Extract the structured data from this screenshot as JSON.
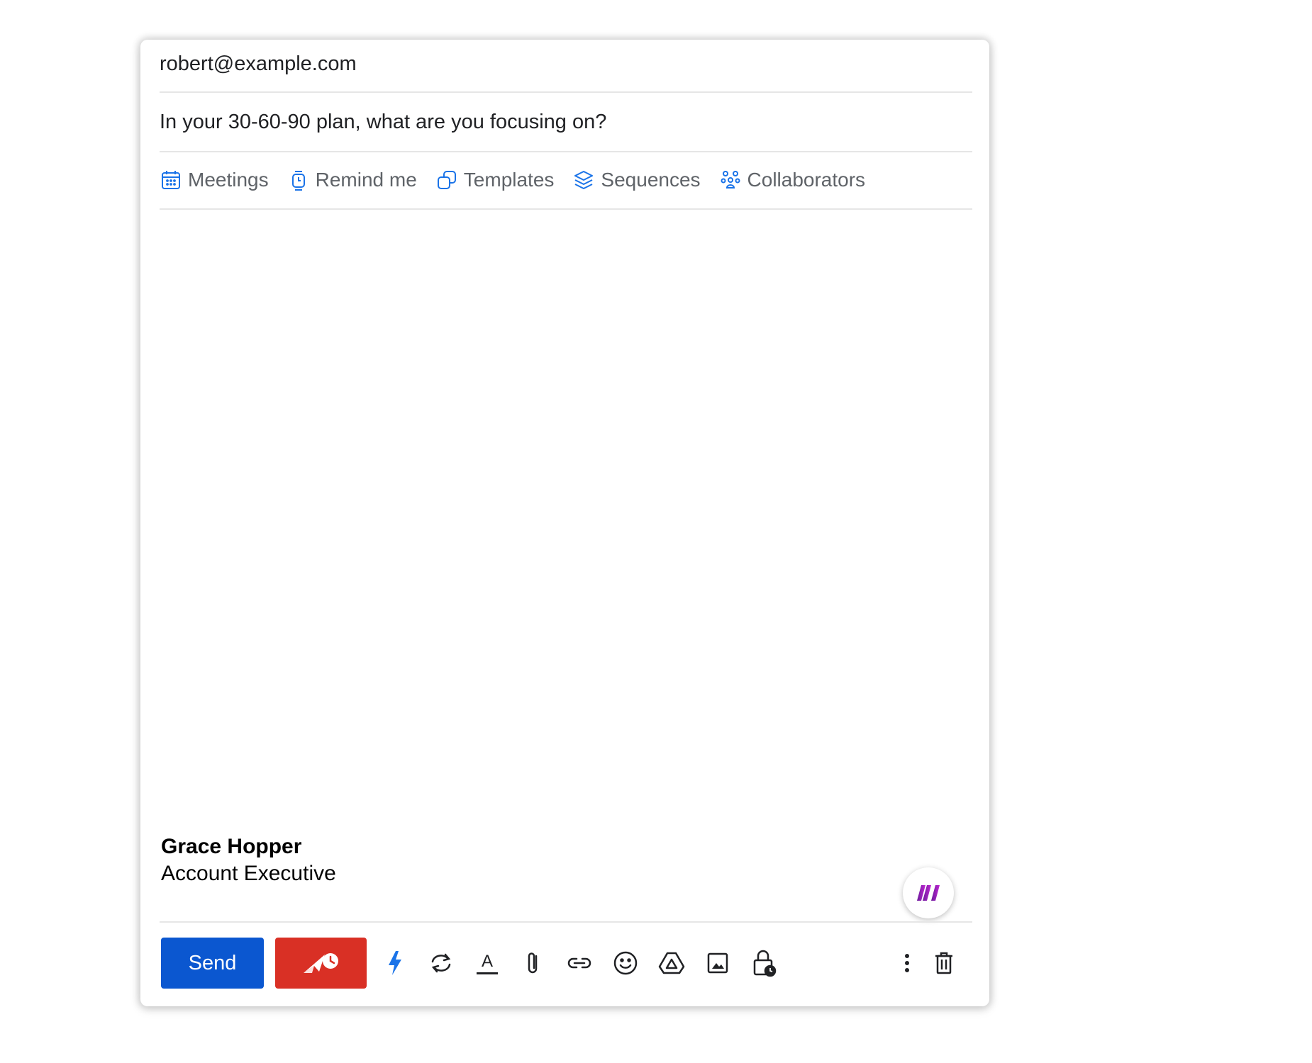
{
  "compose": {
    "to": "robert@example.com",
    "subject": "In your 30-60-90 plan, what are you focusing on?",
    "chips": [
      {
        "label": "Meetings",
        "icon": "calendar-icon"
      },
      {
        "label": "Remind me",
        "icon": "watch-icon"
      },
      {
        "label": "Templates",
        "icon": "templates-icon"
      },
      {
        "label": "Sequences",
        "icon": "layers-icon"
      },
      {
        "label": "Collaborators",
        "icon": "people-icon"
      }
    ],
    "signature": {
      "name": "Grace Hopper",
      "title": "Account Executive"
    }
  },
  "toolbar": {
    "send_label": "Send",
    "tools": [
      "lightning-icon",
      "sync-icon",
      "text-format-icon",
      "attachment-icon",
      "link-icon",
      "emoji-icon",
      "drive-icon",
      "image-icon",
      "confidential-lock-icon",
      "more-options-icon",
      "trash-icon"
    ]
  },
  "colors": {
    "send": "#0b57d0",
    "schedule": "#d93025",
    "chip_icon": "#1a73e8",
    "chip_text": "#5f6368",
    "divider": "#e6e6e6",
    "brand_gradient": [
      "#6a1b9a",
      "#c026d3"
    ]
  }
}
